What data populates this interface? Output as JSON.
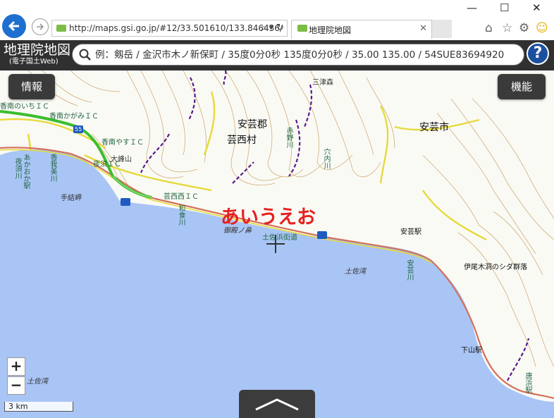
{
  "browser": {
    "url": "http://maps.gsi.go.jp/#12/33.501610/133.846436/",
    "tab_title": "地理院地図",
    "icons": [
      "back-icon",
      "forward-icon",
      "search-icon",
      "refresh-icon",
      "close-icon",
      "home-icon",
      "star-icon",
      "gear-icon",
      "smiley-icon"
    ]
  },
  "header": {
    "logo_main": "地理院地図",
    "logo_sub": "(電子国土Web)",
    "search_placeholder": "例：剱岳 / 金沢市木ノ新保町 / 35度0分0秒 135度0分0秒 / 35.00 135.00 / 54SUE83694920",
    "help_label": "?"
  },
  "map": {
    "info_button": "情報",
    "function_button": "機能",
    "zoom_in": "+",
    "zoom_out": "−",
    "scale_label": "3 km",
    "annotation": "あいうえお",
    "crosshair": "+",
    "colors": {
      "sea": "#a9c5f5",
      "land": "#fafaf5",
      "contour": "#c8a060",
      "road_yellow": "#e6da3a",
      "road_green": "#3dbd2e",
      "accent_red": "#e62020"
    },
    "labels": {
      "aki_gun": "安芸郡",
      "geisei_mura": "芸西村",
      "aki_shi": "安芸市",
      "konan_noichi_ic": "香南のいちＩＣ",
      "konan_kagami_ic": "香南かがみＩＣ",
      "konan_yasu_ic": "香南やすＩＣ",
      "yasu_ic2": "夜須ＩＣ",
      "geisei_nishi_ic": "芸西西ＩＣ",
      "taihozan": "大峰山",
      "tenuimisaki": "手結岬",
      "gogonohana": "御殿ノ鼻",
      "tosahama_kaido": "土佐浜街道",
      "tosa_wan_1": "土佐湾",
      "tosa_wan_2": "土佐湾",
      "aki_eki": "安芸駅",
      "iokimura": "伊尾木洞のシダ群落",
      "akaoka": "あかおか駅",
      "konomi_river": "香我美川",
      "yasu_river": "夜須川",
      "aki_river": "安芸川",
      "akano_river": "赤野川",
      "anai_river": "穴内川",
      "wajiki_river": "和食川",
      "shimoyama_eki": "下山駅",
      "tojin_eki": "唐浜駅",
      "sanjin": "三津森",
      "route55": "55"
    }
  }
}
